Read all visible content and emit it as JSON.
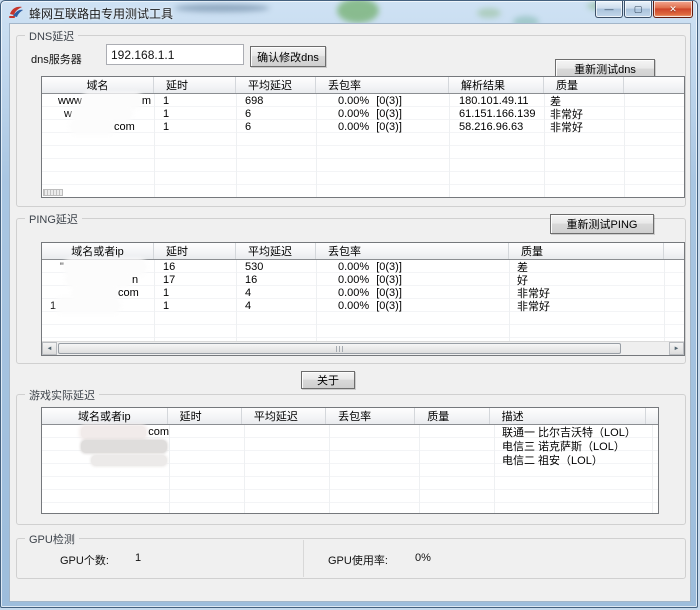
{
  "window": {
    "title": "蜂网互联路由专用测试工具",
    "buttons": {
      "minimize": "—",
      "maximize": "▢",
      "close": "✕"
    }
  },
  "icons": {
    "scroll_left": "◄",
    "scroll_right": "►"
  },
  "colors": {
    "frame_glass": "#a9c6e2",
    "client_bg": "#f0f0f0",
    "close_button_red": "#ce452a",
    "table_border": "#75787c"
  },
  "dns": {
    "group_label": "DNS延迟",
    "server_label": "dns服务器",
    "server_value": "192.168.1.1",
    "confirm_button": "确认修改dns",
    "retest_button": "重新测试dns",
    "headers": [
      "域名",
      "延时",
      "平均延迟",
      "丢包率",
      "解析结果",
      "质量"
    ],
    "rows": [
      {
        "d1": "www",
        "d2": "m",
        "delay": "1",
        "avg": "698",
        "loss": "0.00%",
        "loss_n": "[0(3)]",
        "result": "180.101.49.11",
        "quality": "差"
      },
      {
        "d1": "w",
        "d2": "",
        "delay": "1",
        "avg": "6",
        "loss": "0.00%",
        "loss_n": "[0(3)]",
        "result": "61.151.166.139",
        "quality": "非常好"
      },
      {
        "d1": "",
        "d2": "com",
        "delay": "1",
        "avg": "6",
        "loss": "0.00%",
        "loss_n": "[0(3)]",
        "result": "58.216.96.63",
        "quality": "非常好"
      }
    ]
  },
  "ping": {
    "group_label": "PING延迟",
    "retest_button": "重新测试PING",
    "headers": [
      "域名或者ip",
      "延时",
      "平均延迟",
      "丢包率",
      "质量"
    ],
    "rows": [
      {
        "d1": "\"",
        "d2": "",
        "delay": "16",
        "avg": "530",
        "loss": "0.00%",
        "loss_n": "[0(3)]",
        "quality": "差"
      },
      {
        "d1": "",
        "d2": "n",
        "delay": "17",
        "avg": "16",
        "loss": "0.00%",
        "loss_n": "[0(3)]",
        "quality": "好"
      },
      {
        "d1": "",
        "d2": "com",
        "delay": "1",
        "avg": "4",
        "loss": "0.00%",
        "loss_n": "[0(3)]",
        "quality": "非常好"
      },
      {
        "d1": "1",
        "d2": "",
        "delay": "1",
        "avg": "4",
        "loss": "0.00%",
        "loss_n": "[0(3)]",
        "quality": "非常好"
      }
    ]
  },
  "about_button": "关于",
  "game": {
    "group_label": "游戏实际延迟",
    "headers": [
      "域名或者ip",
      "延时",
      "平均延迟",
      "丢包率",
      "质量",
      "描述"
    ],
    "rows": [
      {
        "d2": "com",
        "desc": "联通一 比尔吉沃特（LOL）"
      },
      {
        "d2": "",
        "desc": "电信三 诺克萨斯（LOL）"
      },
      {
        "d2": "",
        "desc": "电信二 祖安（LOL）"
      }
    ]
  },
  "gpu": {
    "group_label": "GPU检测",
    "count_label": "GPU个数:",
    "count_value": "1",
    "usage_label": "GPU使用率:",
    "usage_value": "0%"
  }
}
